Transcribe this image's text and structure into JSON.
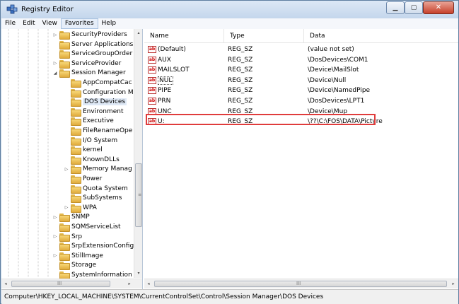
{
  "window": {
    "title": "Registry Editor"
  },
  "menu": [
    "File",
    "Edit",
    "View",
    "Favorites",
    "Help"
  ],
  "tree": {
    "items": [
      {
        "label": "SecurityProviders",
        "indent": 4,
        "expander": "▷"
      },
      {
        "label": "Server Applications",
        "indent": 4,
        "expander": ""
      },
      {
        "label": "ServiceGroupOrder",
        "indent": 4,
        "expander": ""
      },
      {
        "label": "ServiceProvider",
        "indent": 4,
        "expander": "▷"
      },
      {
        "label": "Session Manager",
        "indent": 4,
        "expander": "◢"
      },
      {
        "label": "AppCompatCac",
        "indent": 5,
        "expander": ""
      },
      {
        "label": "Configuration M",
        "indent": 5,
        "expander": ""
      },
      {
        "label": "DOS Devices",
        "indent": 5,
        "expander": "",
        "selected": true
      },
      {
        "label": "Environment",
        "indent": 5,
        "expander": ""
      },
      {
        "label": "Executive",
        "indent": 5,
        "expander": ""
      },
      {
        "label": "FileRenameOpe",
        "indent": 5,
        "expander": ""
      },
      {
        "label": "I/O System",
        "indent": 5,
        "expander": ""
      },
      {
        "label": "kernel",
        "indent": 5,
        "expander": ""
      },
      {
        "label": "KnownDLLs",
        "indent": 5,
        "expander": ""
      },
      {
        "label": "Memory Manag",
        "indent": 5,
        "expander": "▷"
      },
      {
        "label": "Power",
        "indent": 5,
        "expander": ""
      },
      {
        "label": "Quota System",
        "indent": 5,
        "expander": ""
      },
      {
        "label": "SubSystems",
        "indent": 5,
        "expander": ""
      },
      {
        "label": "WPA",
        "indent": 5,
        "expander": "▷"
      },
      {
        "label": "SNMP",
        "indent": 4,
        "expander": "▷"
      },
      {
        "label": "SQMServiceList",
        "indent": 4,
        "expander": ""
      },
      {
        "label": "Srp",
        "indent": 4,
        "expander": "▷"
      },
      {
        "label": "SrpExtensionConfig",
        "indent": 4,
        "expander": ""
      },
      {
        "label": "StillImage",
        "indent": 4,
        "expander": "▷"
      },
      {
        "label": "Storage",
        "indent": 4,
        "expander": ""
      },
      {
        "label": "SystemInformation",
        "indent": 4,
        "expander": ""
      }
    ]
  },
  "list": {
    "headers": [
      "Name",
      "Type",
      "Data"
    ],
    "rows": [
      {
        "name": "(Default)",
        "type": "REG_SZ",
        "data": "(value not set)"
      },
      {
        "name": "AUX",
        "type": "REG_SZ",
        "data": "\\DosDevices\\COM1"
      },
      {
        "name": "MAILSLOT",
        "type": "REG_SZ",
        "data": "\\Device\\MailSlot"
      },
      {
        "name": "NUL",
        "type": "REG_SZ",
        "data": "\\Device\\Null"
      },
      {
        "name": "PIPE",
        "type": "REG_SZ",
        "data": "\\Device\\NamedPipe"
      },
      {
        "name": "PRN",
        "type": "REG_SZ",
        "data": "\\DosDevices\\LPT1"
      },
      {
        "name": "UNC",
        "type": "REG_SZ",
        "data": "\\Device\\Mup"
      },
      {
        "name": "U:",
        "type": "REG_SZ",
        "data": "\\??\\C:\\FOS\\DATA\\Pictyre"
      }
    ],
    "value_icon": "ab"
  },
  "status": {
    "path": "Computer\\HKEY_LOCAL_MACHINE\\SYSTEM\\CurrentControlSet\\Control\\Session Manager\\DOS Devices"
  },
  "scroll": {
    "left": "◂",
    "right": "▸",
    "up": "▴",
    "down": "▾",
    "grip": "III",
    "vgrip": "≡"
  },
  "colors": {
    "highlight": "#e03c3c",
    "folder": "#e0ab3c",
    "value_icon": "#cc0000"
  }
}
